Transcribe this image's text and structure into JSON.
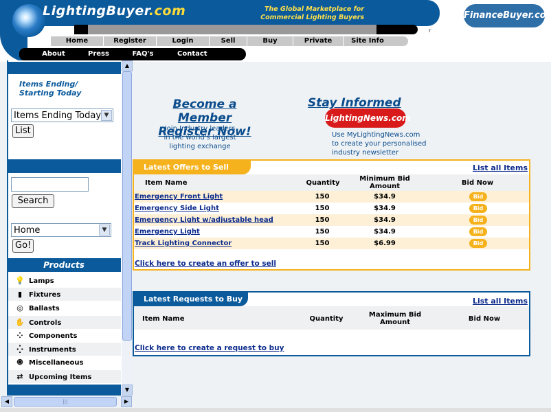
{
  "header": {
    "site_name": "LightingBuyer",
    "site_domain": ".com",
    "tagline_line1": "The Global Marketplace for",
    "tagline_line2": "Commercial Lighting Buyers",
    "partner_logo": "FinanceBuyer.com",
    "partner_mark": "r",
    "nav_primary": [
      "Home",
      "Register",
      "Login",
      "Sell",
      "Buy",
      "Private",
      "Site Info"
    ],
    "nav_secondary": [
      "About",
      "Press",
      "FAQ's",
      "Contact"
    ]
  },
  "sidebar": {
    "ending_title_line1": "Items Ending/",
    "ending_title_line2": "Starting Today",
    "ending_select_value": "Items Ending Today",
    "list_button": "List",
    "search_value": "",
    "search_button": "Search",
    "jump_select_value": "Home",
    "go_button": "Go!",
    "products_heading": "Products",
    "products": [
      {
        "label": "Lamps",
        "icon": "lamp-icon"
      },
      {
        "label": "Fixtures",
        "icon": "fixture-icon"
      },
      {
        "label": "Ballasts",
        "icon": "ballast-icon"
      },
      {
        "label": "Controls",
        "icon": "controls-icon"
      },
      {
        "label": "Components",
        "icon": "components-icon"
      },
      {
        "label": "Instruments",
        "icon": "instruments-icon"
      },
      {
        "label": "Miscellaneous",
        "icon": "misc-icon"
      },
      {
        "label": "Upcoming Items",
        "icon": "upcoming-icon"
      }
    ]
  },
  "promo": {
    "member_title_line1": "Become a Member",
    "member_title_line2": "Register Now!",
    "member_sub_line1": "Join Industry leaders",
    "member_sub_line2": "in the world's largest",
    "member_sub_line3": "lighting exchange",
    "informed_title": "Stay Informed",
    "informed_logo": "LightingNews.com",
    "informed_sub_line1": "Use MyLightingNews.com",
    "informed_sub_line2": "to create your personalised",
    "informed_sub_line3": "industry newsletter"
  },
  "offers": {
    "title": "Latest Offers to Sell",
    "list_all": "List all Items",
    "col_name": "Item Name",
    "col_qty": "Quantity",
    "col_bid_line1": "Minimum Bid",
    "col_bid_line2": "Amount",
    "col_bid_now": "Bid Now",
    "bid_label": "Bid",
    "rows": [
      {
        "name": "Emergency Front Light",
        "qty": "150",
        "price": "$34.9"
      },
      {
        "name": "Emergency Side Light",
        "qty": "150",
        "price": "$34.9"
      },
      {
        "name": "Emergency Light w/adjustable head",
        "qty": "150",
        "price": "$34.9"
      },
      {
        "name": "Emergency Light",
        "qty": "150",
        "price": "$34.9"
      },
      {
        "name": "Track Lighting Connector",
        "qty": "150",
        "price": "$6.99"
      }
    ],
    "create_link": "Click here to create an offer to sell"
  },
  "requests": {
    "title": "Latest Requests to Buy",
    "list_all": "List all Items",
    "col_name": "Item Name",
    "col_qty": "Quantity",
    "col_bid_line1": "Maximum Bid",
    "col_bid_line2": "Amount",
    "col_bid_now": "Bid Now",
    "create_link": "Click here to create a request to buy"
  },
  "colors": {
    "brand_blue": "#0b5a9c",
    "accent_orange": "#f5b21c",
    "link_blue": "#0b2a8c"
  }
}
